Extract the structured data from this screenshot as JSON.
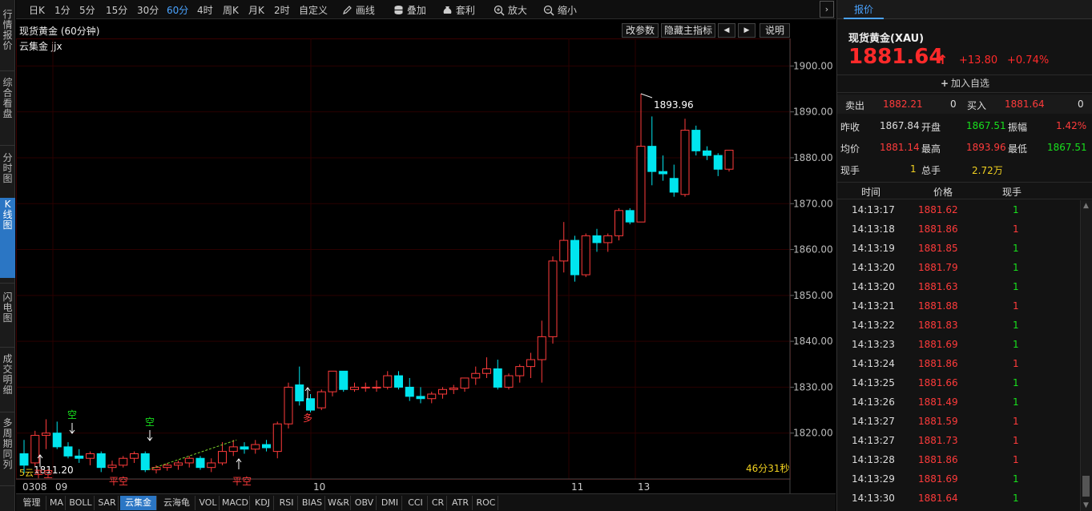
{
  "leftnav": {
    "items": [
      {
        "label": "行情报价",
        "active": false
      },
      {
        "label": "综合看盘",
        "active": false
      },
      {
        "label": "分时图",
        "active": false
      },
      {
        "label": "K线图",
        "active": true
      },
      {
        "label": "闪电图",
        "active": false
      },
      {
        "label": "成交明细",
        "active": false
      },
      {
        "label": "多周期同列",
        "active": false
      }
    ]
  },
  "toolbar": {
    "periods": [
      "日K",
      "1分",
      "5分",
      "15分",
      "30分",
      "60分",
      "4时",
      "周K",
      "月K",
      "2时",
      "自定义"
    ],
    "active_period": "60分",
    "tools": {
      "draw": "画线",
      "overlay": "叠加",
      "arbitrage": "套利",
      "zoom_in": "放大",
      "zoom_out": "缩小"
    },
    "arrow": "›"
  },
  "chart_header": {
    "title": "现货黄金 (60分钟)",
    "buttons": {
      "params": "改参数",
      "hide_main": "隐藏主指标",
      "prev": "◀",
      "next": "▶",
      "help": "说明"
    },
    "indicator_name": "云集金 jjx"
  },
  "chart_data": {
    "type": "candlestick",
    "title": "现货黄金 (60分钟)",
    "ylim": [
      1810,
      1906
    ],
    "y_ticks": [
      "1820.00",
      "1830.00",
      "1840.00",
      "1850.00",
      "1860.00",
      "1870.00",
      "1880.00",
      "1890.00",
      "1900.00"
    ],
    "x_tick_labels": [
      "0308",
      "09",
      "10",
      "11",
      "13"
    ],
    "candles": [
      {
        "o": 1815.5,
        "h": 1818.5,
        "l": 1811.2,
        "c": 1813.0
      },
      {
        "o": 1813.5,
        "h": 1820.5,
        "l": 1812.8,
        "c": 1819.5
      },
      {
        "o": 1819.5,
        "h": 1823.0,
        "l": 1816.5,
        "c": 1820.0
      },
      {
        "o": 1820.0,
        "h": 1822.5,
        "l": 1816.5,
        "c": 1817.0
      },
      {
        "o": 1817.0,
        "h": 1818.0,
        "l": 1814.5,
        "c": 1815.0
      },
      {
        "o": 1815.0,
        "h": 1816.5,
        "l": 1813.5,
        "c": 1814.5
      },
      {
        "o": 1814.5,
        "h": 1816.0,
        "l": 1813.0,
        "c": 1815.5
      },
      {
        "o": 1815.5,
        "h": 1816.0,
        "l": 1811.5,
        "c": 1812.5
      },
      {
        "o": 1812.5,
        "h": 1814.0,
        "l": 1811.5,
        "c": 1813.0
      },
      {
        "o": 1813.0,
        "h": 1815.0,
        "l": 1812.5,
        "c": 1814.5
      },
      {
        "o": 1814.5,
        "h": 1816.0,
        "l": 1813.5,
        "c": 1815.5
      },
      {
        "o": 1815.5,
        "h": 1816.0,
        "l": 1811.5,
        "c": 1812.0
      },
      {
        "o": 1812.0,
        "h": 1813.0,
        "l": 1811.2,
        "c": 1812.5
      },
      {
        "o": 1812.5,
        "h": 1813.5,
        "l": 1811.8,
        "c": 1813.0
      },
      {
        "o": 1813.0,
        "h": 1814.0,
        "l": 1812.0,
        "c": 1813.5
      },
      {
        "o": 1813.5,
        "h": 1815.0,
        "l": 1812.5,
        "c": 1814.5
      },
      {
        "o": 1814.5,
        "h": 1815.0,
        "l": 1812.0,
        "c": 1812.5
      },
      {
        "o": 1812.5,
        "h": 1814.5,
        "l": 1811.5,
        "c": 1813.5
      },
      {
        "o": 1813.5,
        "h": 1818.0,
        "l": 1813.0,
        "c": 1816.0
      },
      {
        "o": 1816.0,
        "h": 1818.5,
        "l": 1815.0,
        "c": 1817.0
      },
      {
        "o": 1817.0,
        "h": 1818.0,
        "l": 1815.5,
        "c": 1816.5
      },
      {
        "o": 1816.5,
        "h": 1818.5,
        "l": 1815.5,
        "c": 1817.5
      },
      {
        "o": 1817.5,
        "h": 1818.5,
        "l": 1816.0,
        "c": 1816.8
      },
      {
        "o": 1816.0,
        "h": 1822.5,
        "l": 1814.5,
        "c": 1822.0
      },
      {
        "o": 1822.0,
        "h": 1831.0,
        "l": 1821.0,
        "c": 1830.0
      },
      {
        "o": 1830.5,
        "h": 1834.5,
        "l": 1826.0,
        "c": 1827.0
      },
      {
        "o": 1827.5,
        "h": 1828.5,
        "l": 1824.5,
        "c": 1825.0
      },
      {
        "o": 1825.5,
        "h": 1829.5,
        "l": 1825.0,
        "c": 1829.0
      },
      {
        "o": 1829.0,
        "h": 1833.5,
        "l": 1828.0,
        "c": 1833.5
      },
      {
        "o": 1833.5,
        "h": 1833.5,
        "l": 1829.0,
        "c": 1829.5
      },
      {
        "o": 1829.5,
        "h": 1831.0,
        "l": 1829.0,
        "c": 1830.0
      },
      {
        "o": 1830.0,
        "h": 1831.0,
        "l": 1829.0,
        "c": 1830.0
      },
      {
        "o": 1830.0,
        "h": 1831.5,
        "l": 1829.0,
        "c": 1830.0
      },
      {
        "o": 1830.0,
        "h": 1833.5,
        "l": 1829.5,
        "c": 1832.5
      },
      {
        "o": 1832.5,
        "h": 1833.5,
        "l": 1829.5,
        "c": 1830.0
      },
      {
        "o": 1830.0,
        "h": 1832.0,
        "l": 1827.0,
        "c": 1828.0
      },
      {
        "o": 1828.0,
        "h": 1830.0,
        "l": 1826.5,
        "c": 1827.5
      },
      {
        "o": 1827.5,
        "h": 1829.0,
        "l": 1826.5,
        "c": 1828.5
      },
      {
        "o": 1828.5,
        "h": 1830.0,
        "l": 1827.5,
        "c": 1829.5
      },
      {
        "o": 1829.5,
        "h": 1830.5,
        "l": 1828.5,
        "c": 1829.8
      },
      {
        "o": 1829.8,
        "h": 1832.0,
        "l": 1829.0,
        "c": 1832.0
      },
      {
        "o": 1832.0,
        "h": 1834.5,
        "l": 1830.5,
        "c": 1833.0
      },
      {
        "o": 1833.0,
        "h": 1836.5,
        "l": 1832.0,
        "c": 1834.0
      },
      {
        "o": 1834.0,
        "h": 1836.0,
        "l": 1829.5,
        "c": 1830.0
      },
      {
        "o": 1830.0,
        "h": 1833.0,
        "l": 1829.5,
        "c": 1832.5
      },
      {
        "o": 1832.5,
        "h": 1835.0,
        "l": 1831.0,
        "c": 1834.5
      },
      {
        "o": 1834.5,
        "h": 1837.5,
        "l": 1832.0,
        "c": 1836.0
      },
      {
        "o": 1836.0,
        "h": 1844.5,
        "l": 1831.0,
        "c": 1841.0
      },
      {
        "o": 1841.0,
        "h": 1858.5,
        "l": 1839.5,
        "c": 1857.5
      },
      {
        "o": 1857.5,
        "h": 1866.0,
        "l": 1855.0,
        "c": 1862.0
      },
      {
        "o": 1862.0,
        "h": 1863.0,
        "l": 1853.0,
        "c": 1854.5
      },
      {
        "o": 1854.5,
        "h": 1863.5,
        "l": 1854.0,
        "c": 1863.0
      },
      {
        "o": 1863.0,
        "h": 1864.5,
        "l": 1859.5,
        "c": 1861.5
      },
      {
        "o": 1861.5,
        "h": 1863.5,
        "l": 1859.5,
        "c": 1863.0
      },
      {
        "o": 1863.0,
        "h": 1869.0,
        "l": 1862.0,
        "c": 1868.5
      },
      {
        "o": 1868.5,
        "h": 1869.0,
        "l": 1865.5,
        "c": 1866.0
      },
      {
        "o": 1866.0,
        "h": 1893.96,
        "l": 1866.0,
        "c": 1882.5
      },
      {
        "o": 1882.5,
        "h": 1889.0,
        "l": 1874.0,
        "c": 1877.0
      },
      {
        "o": 1877.0,
        "h": 1880.5,
        "l": 1875.0,
        "c": 1876.5
      },
      {
        "o": 1875.5,
        "h": 1878.5,
        "l": 1871.5,
        "c": 1872.5
      },
      {
        "o": 1872.0,
        "h": 1888.5,
        "l": 1871.5,
        "c": 1886.0
      },
      {
        "o": 1886.0,
        "h": 1887.0,
        "l": 1880.5,
        "c": 1881.5
      },
      {
        "o": 1881.5,
        "h": 1882.5,
        "l": 1879.5,
        "c": 1880.5
      },
      {
        "o": 1880.5,
        "h": 1881.0,
        "l": 1876.0,
        "c": 1877.5
      },
      {
        "o": 1877.51,
        "h": 1881.5,
        "l": 1877.0,
        "c": 1881.64
      }
    ],
    "annotations": {
      "high_label": "1893.96",
      "low_label": "1811.20",
      "signals": [
        {
          "text": "空",
          "color": "#18e01d",
          "index": 3,
          "dir": "down"
        },
        {
          "text": "空",
          "color": "#18e01d",
          "index": 11,
          "dir": "down"
        },
        {
          "text": "多",
          "color": "#ff3b3b",
          "index": 25,
          "dir": "up"
        },
        {
          "text": "平空",
          "color": "#ff3b3b",
          "index": 1,
          "dir": "up"
        },
        {
          "text": "平空",
          "color": "#ff3b3b",
          "index": 8,
          "dir": "none"
        },
        {
          "text": "平空",
          "color": "#ff3b3b",
          "index": 19,
          "dir": "up"
        }
      ],
      "small_tag": "5云",
      "countdown": "46分31秒"
    }
  },
  "bottombar": {
    "items": [
      "管理",
      "MA",
      "BOLL",
      "SAR",
      "云集金",
      "云海龟",
      "VOL",
      "MACD",
      "KDJ",
      "RSI",
      "BIAS",
      "W&R",
      "OBV",
      "DMI",
      "CCI",
      "CR",
      "ATR",
      "ROC"
    ],
    "active": "云集金"
  },
  "quote_panel": {
    "tab": "报价",
    "name": "现货黄金(XAU)",
    "price": "1881.64",
    "change": "+13.80",
    "change_pct": "+0.74%",
    "add_watch": "加入自选",
    "sell_label": "卖出",
    "sell_price": "1882.21",
    "sell_qty": "0",
    "buy_label": "买入",
    "buy_price": "1881.64",
    "buy_qty": "0",
    "stats": {
      "prev_close_label": "昨收",
      "prev_close": "1867.84",
      "open_label": "开盘",
      "open": "1867.51",
      "amplitude_label": "振幅",
      "amplitude": "1.42%",
      "avg_label": "均价",
      "avg": "1881.14",
      "high_label": "最高",
      "high": "1893.96",
      "low_label": "最低",
      "low": "1867.51",
      "now_hand_label": "现手",
      "now_hand": "1",
      "total_hand_label": "总手",
      "total_hand": "2.72万"
    },
    "trades_header": {
      "time": "时间",
      "price": "价格",
      "hand": "现手"
    },
    "trades": [
      {
        "time": "14:13:17",
        "price": "1881.62",
        "hand": "1",
        "dir": "green"
      },
      {
        "time": "14:13:18",
        "price": "1881.86",
        "hand": "1",
        "dir": "red"
      },
      {
        "time": "14:13:19",
        "price": "1881.85",
        "hand": "1",
        "dir": "green"
      },
      {
        "time": "14:13:20",
        "price": "1881.79",
        "hand": "1",
        "dir": "green"
      },
      {
        "time": "14:13:20",
        "price": "1881.63",
        "hand": "1",
        "dir": "green"
      },
      {
        "time": "14:13:21",
        "price": "1881.88",
        "hand": "1",
        "dir": "red"
      },
      {
        "time": "14:13:22",
        "price": "1881.83",
        "hand": "1",
        "dir": "green"
      },
      {
        "time": "14:13:23",
        "price": "1881.69",
        "hand": "1",
        "dir": "green"
      },
      {
        "time": "14:13:24",
        "price": "1881.86",
        "hand": "1",
        "dir": "red"
      },
      {
        "time": "14:13:25",
        "price": "1881.66",
        "hand": "1",
        "dir": "green"
      },
      {
        "time": "14:13:26",
        "price": "1881.49",
        "hand": "1",
        "dir": "green"
      },
      {
        "time": "14:13:27",
        "price": "1881.59",
        "hand": "1",
        "dir": "red"
      },
      {
        "time": "14:13:27",
        "price": "1881.73",
        "hand": "1",
        "dir": "red"
      },
      {
        "time": "14:13:28",
        "price": "1881.86",
        "hand": "1",
        "dir": "red"
      },
      {
        "time": "14:13:29",
        "price": "1881.69",
        "hand": "1",
        "dir": "green"
      },
      {
        "time": "14:13:30",
        "price": "1881.64",
        "hand": "1",
        "dir": "green"
      }
    ]
  },
  "colors": {
    "up": "#ff3b3b",
    "down": "#00e5ee",
    "grid": "#2a0000",
    "accent": "#2b76c4"
  }
}
